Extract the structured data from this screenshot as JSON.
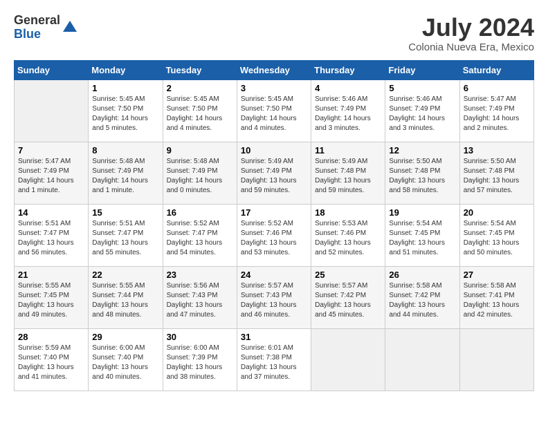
{
  "logo": {
    "general": "General",
    "blue": "Blue"
  },
  "title": {
    "month": "July 2024",
    "location": "Colonia Nueva Era, Mexico"
  },
  "headers": [
    "Sunday",
    "Monday",
    "Tuesday",
    "Wednesday",
    "Thursday",
    "Friday",
    "Saturday"
  ],
  "weeks": [
    [
      {
        "day": "",
        "info": ""
      },
      {
        "day": "1",
        "info": "Sunrise: 5:45 AM\nSunset: 7:50 PM\nDaylight: 14 hours\nand 5 minutes."
      },
      {
        "day": "2",
        "info": "Sunrise: 5:45 AM\nSunset: 7:50 PM\nDaylight: 14 hours\nand 4 minutes."
      },
      {
        "day": "3",
        "info": "Sunrise: 5:45 AM\nSunset: 7:50 PM\nDaylight: 14 hours\nand 4 minutes."
      },
      {
        "day": "4",
        "info": "Sunrise: 5:46 AM\nSunset: 7:49 PM\nDaylight: 14 hours\nand 3 minutes."
      },
      {
        "day": "5",
        "info": "Sunrise: 5:46 AM\nSunset: 7:49 PM\nDaylight: 14 hours\nand 3 minutes."
      },
      {
        "day": "6",
        "info": "Sunrise: 5:47 AM\nSunset: 7:49 PM\nDaylight: 14 hours\nand 2 minutes."
      }
    ],
    [
      {
        "day": "7",
        "info": "Sunrise: 5:47 AM\nSunset: 7:49 PM\nDaylight: 14 hours\nand 1 minute."
      },
      {
        "day": "8",
        "info": "Sunrise: 5:48 AM\nSunset: 7:49 PM\nDaylight: 14 hours\nand 1 minute."
      },
      {
        "day": "9",
        "info": "Sunrise: 5:48 AM\nSunset: 7:49 PM\nDaylight: 14 hours\nand 0 minutes."
      },
      {
        "day": "10",
        "info": "Sunrise: 5:49 AM\nSunset: 7:49 PM\nDaylight: 13 hours\nand 59 minutes."
      },
      {
        "day": "11",
        "info": "Sunrise: 5:49 AM\nSunset: 7:48 PM\nDaylight: 13 hours\nand 59 minutes."
      },
      {
        "day": "12",
        "info": "Sunrise: 5:50 AM\nSunset: 7:48 PM\nDaylight: 13 hours\nand 58 minutes."
      },
      {
        "day": "13",
        "info": "Sunrise: 5:50 AM\nSunset: 7:48 PM\nDaylight: 13 hours\nand 57 minutes."
      }
    ],
    [
      {
        "day": "14",
        "info": "Sunrise: 5:51 AM\nSunset: 7:47 PM\nDaylight: 13 hours\nand 56 minutes."
      },
      {
        "day": "15",
        "info": "Sunrise: 5:51 AM\nSunset: 7:47 PM\nDaylight: 13 hours\nand 55 minutes."
      },
      {
        "day": "16",
        "info": "Sunrise: 5:52 AM\nSunset: 7:47 PM\nDaylight: 13 hours\nand 54 minutes."
      },
      {
        "day": "17",
        "info": "Sunrise: 5:52 AM\nSunset: 7:46 PM\nDaylight: 13 hours\nand 53 minutes."
      },
      {
        "day": "18",
        "info": "Sunrise: 5:53 AM\nSunset: 7:46 PM\nDaylight: 13 hours\nand 52 minutes."
      },
      {
        "day": "19",
        "info": "Sunrise: 5:54 AM\nSunset: 7:45 PM\nDaylight: 13 hours\nand 51 minutes."
      },
      {
        "day": "20",
        "info": "Sunrise: 5:54 AM\nSunset: 7:45 PM\nDaylight: 13 hours\nand 50 minutes."
      }
    ],
    [
      {
        "day": "21",
        "info": "Sunrise: 5:55 AM\nSunset: 7:45 PM\nDaylight: 13 hours\nand 49 minutes."
      },
      {
        "day": "22",
        "info": "Sunrise: 5:55 AM\nSunset: 7:44 PM\nDaylight: 13 hours\nand 48 minutes."
      },
      {
        "day": "23",
        "info": "Sunrise: 5:56 AM\nSunset: 7:43 PM\nDaylight: 13 hours\nand 47 minutes."
      },
      {
        "day": "24",
        "info": "Sunrise: 5:57 AM\nSunset: 7:43 PM\nDaylight: 13 hours\nand 46 minutes."
      },
      {
        "day": "25",
        "info": "Sunrise: 5:57 AM\nSunset: 7:42 PM\nDaylight: 13 hours\nand 45 minutes."
      },
      {
        "day": "26",
        "info": "Sunrise: 5:58 AM\nSunset: 7:42 PM\nDaylight: 13 hours\nand 44 minutes."
      },
      {
        "day": "27",
        "info": "Sunrise: 5:58 AM\nSunset: 7:41 PM\nDaylight: 13 hours\nand 42 minutes."
      }
    ],
    [
      {
        "day": "28",
        "info": "Sunrise: 5:59 AM\nSunset: 7:40 PM\nDaylight: 13 hours\nand 41 minutes."
      },
      {
        "day": "29",
        "info": "Sunrise: 6:00 AM\nSunset: 7:40 PM\nDaylight: 13 hours\nand 40 minutes."
      },
      {
        "day": "30",
        "info": "Sunrise: 6:00 AM\nSunset: 7:39 PM\nDaylight: 13 hours\nand 38 minutes."
      },
      {
        "day": "31",
        "info": "Sunrise: 6:01 AM\nSunset: 7:38 PM\nDaylight: 13 hours\nand 37 minutes."
      },
      {
        "day": "",
        "info": ""
      },
      {
        "day": "",
        "info": ""
      },
      {
        "day": "",
        "info": ""
      }
    ]
  ]
}
